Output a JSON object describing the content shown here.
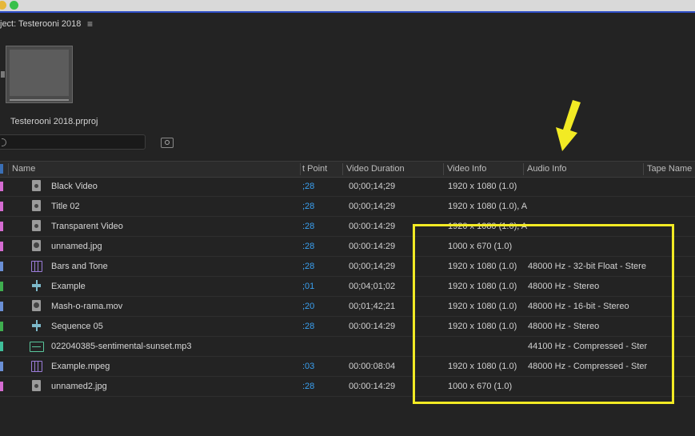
{
  "panel": {
    "title": "ject: Testerooni 2018",
    "menu_glyph": "≡",
    "project_file": "Testerooni 2018.prproj",
    "search_value": "",
    "search_placeholder": ""
  },
  "columns": {
    "name": "Name",
    "in_point": "t Point",
    "video_duration": "Video Duration",
    "video_info": "Video Info",
    "audio_info": "Audio Info",
    "tape_name": "Tape Name"
  },
  "rows": [
    {
      "color": "#d56bd1",
      "icon": "clip-icon",
      "name": "Black Video",
      "in": ";28",
      "dur": "00;00;14;29",
      "vinfo": "1920 x 1080 (1.0)",
      "ainfo": ""
    },
    {
      "color": "#d56bd1",
      "icon": "clip-icon",
      "name": "Title 02",
      "in": ";28",
      "dur": "00;00;14;29",
      "vinfo": "1920 x 1080 (1.0), A",
      "ainfo": ""
    },
    {
      "color": "#d56bd1",
      "icon": "clip-icon",
      "name": "Transparent Video",
      "in": ":28",
      "dur": "00:00:14:29",
      "vinfo": "1920 x 1080 (1.0), A",
      "ainfo": ""
    },
    {
      "color": "#d56bd1",
      "icon": "image-icon",
      "name": "unnamed.jpg",
      "in": ":28",
      "dur": "00:00:14:29",
      "vinfo": "1000 x 670 (1.0)",
      "ainfo": ""
    },
    {
      "color": "#6a8fd6",
      "icon": "bars-tone-icon",
      "name": "Bars and Tone",
      "in": ";28",
      "dur": "00;00;14;29",
      "vinfo": "1920 x 1080 (1.0)",
      "ainfo": "48000 Hz - 32-bit Float - Stere"
    },
    {
      "color": "#3fae4f",
      "icon": "sequence-icon",
      "name": "Example",
      "in": ";01",
      "dur": "00;04;01;02",
      "vinfo": "1920 x 1080 (1.0)",
      "ainfo": "48000 Hz - Stereo"
    },
    {
      "color": "#6a8fd6",
      "icon": "image-icon",
      "name": "Mash-o-rama.mov",
      "in": ";20",
      "dur": "00;01;42;21",
      "vinfo": "1920 x 1080 (1.0)",
      "ainfo": "48000 Hz - 16-bit - Stereo"
    },
    {
      "color": "#3fae4f",
      "icon": "sequence-icon",
      "name": "Sequence 05",
      "in": ":28",
      "dur": "00:00:14:29",
      "vinfo": "1920 x 1080 (1.0)",
      "ainfo": "48000 Hz - Stereo"
    },
    {
      "color": "#3fbf9a",
      "icon": "audio-icon",
      "name": "022040385-sentimental-sunset.mp3",
      "in": "",
      "dur": "",
      "vinfo": "",
      "ainfo": "44100 Hz - Compressed - Ster"
    },
    {
      "color": "#6a8fd6",
      "icon": "bars-tone-icon",
      "name": "Example.mpeg",
      "in": ":03",
      "dur": "00:00:08:04",
      "vinfo": "1920 x 1080 (1.0)",
      "ainfo": "48000 Hz - Compressed - Ster"
    },
    {
      "color": "#d56bd1",
      "icon": "clip-icon",
      "name": "unnamed2.jpg",
      "in": ":28",
      "dur": "00:00:14:29",
      "vinfo": "1000 x 670 (1.0)",
      "ainfo": ""
    }
  ],
  "annotations": {
    "highlight_color": "#f2ea24",
    "arrow_color": "#f2ea24"
  }
}
